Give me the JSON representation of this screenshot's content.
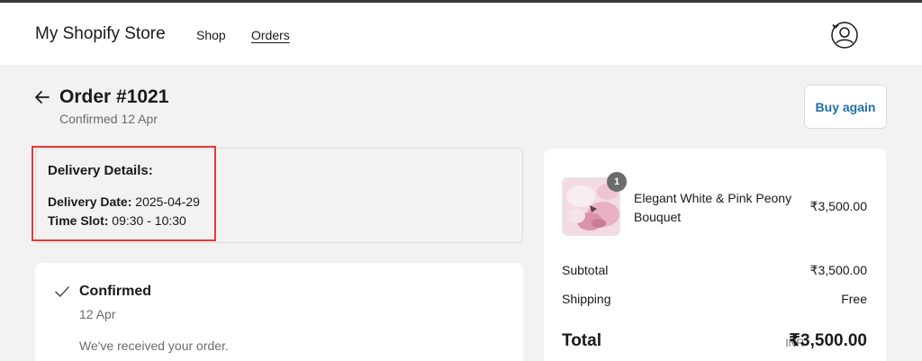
{
  "header": {
    "store_name": "My Shopify Store",
    "nav": {
      "shop": "Shop",
      "orders": "Orders"
    }
  },
  "order": {
    "title": "Order #1021",
    "subtitle": "Confirmed 12 Apr",
    "buy_again_label": "Buy again"
  },
  "delivery": {
    "heading": "Delivery Details:",
    "date_label": "Delivery Date:",
    "date_value": " 2025-04-29",
    "slot_label": "Time Slot:",
    "slot_value": " 09:30 - 10:30"
  },
  "status": {
    "title": "Confirmed",
    "date": "12 Apr",
    "message": "We've received your order."
  },
  "summary": {
    "item": {
      "quantity": "1",
      "name": "Elegant White & Pink Peony Bouquet",
      "price": "₹3,500.00"
    },
    "subtotal_label": "Subtotal",
    "subtotal_value": "₹3,500.00",
    "shipping_label": "Shipping",
    "shipping_value": "Free",
    "total_label": "Total",
    "total_currency": "INR",
    "total_value": "₹3,500.00"
  },
  "colors": {
    "accent": "#1f6fa8",
    "highlight_box": "#e53935",
    "page_bg": "#f2f2f2"
  }
}
